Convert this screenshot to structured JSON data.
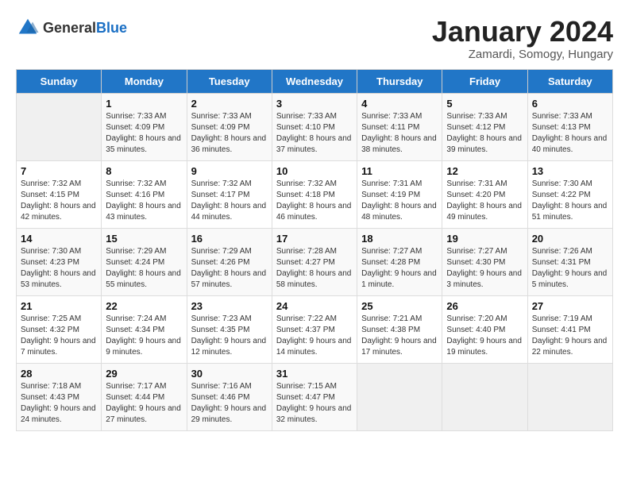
{
  "logo": {
    "general": "General",
    "blue": "Blue"
  },
  "header": {
    "month": "January 2024",
    "location": "Zamardi, Somogy, Hungary"
  },
  "days_of_week": [
    "Sunday",
    "Monday",
    "Tuesday",
    "Wednesday",
    "Thursday",
    "Friday",
    "Saturday"
  ],
  "weeks": [
    [
      {
        "day": "",
        "sunrise": "",
        "sunset": "",
        "daylight": "",
        "empty": true
      },
      {
        "day": "1",
        "sunrise": "Sunrise: 7:33 AM",
        "sunset": "Sunset: 4:09 PM",
        "daylight": "Daylight: 8 hours and 35 minutes."
      },
      {
        "day": "2",
        "sunrise": "Sunrise: 7:33 AM",
        "sunset": "Sunset: 4:09 PM",
        "daylight": "Daylight: 8 hours and 36 minutes."
      },
      {
        "day": "3",
        "sunrise": "Sunrise: 7:33 AM",
        "sunset": "Sunset: 4:10 PM",
        "daylight": "Daylight: 8 hours and 37 minutes."
      },
      {
        "day": "4",
        "sunrise": "Sunrise: 7:33 AM",
        "sunset": "Sunset: 4:11 PM",
        "daylight": "Daylight: 8 hours and 38 minutes."
      },
      {
        "day": "5",
        "sunrise": "Sunrise: 7:33 AM",
        "sunset": "Sunset: 4:12 PM",
        "daylight": "Daylight: 8 hours and 39 minutes."
      },
      {
        "day": "6",
        "sunrise": "Sunrise: 7:33 AM",
        "sunset": "Sunset: 4:13 PM",
        "daylight": "Daylight: 8 hours and 40 minutes."
      }
    ],
    [
      {
        "day": "7",
        "sunrise": "Sunrise: 7:32 AM",
        "sunset": "Sunset: 4:15 PM",
        "daylight": "Daylight: 8 hours and 42 minutes."
      },
      {
        "day": "8",
        "sunrise": "Sunrise: 7:32 AM",
        "sunset": "Sunset: 4:16 PM",
        "daylight": "Daylight: 8 hours and 43 minutes."
      },
      {
        "day": "9",
        "sunrise": "Sunrise: 7:32 AM",
        "sunset": "Sunset: 4:17 PM",
        "daylight": "Daylight: 8 hours and 44 minutes."
      },
      {
        "day": "10",
        "sunrise": "Sunrise: 7:32 AM",
        "sunset": "Sunset: 4:18 PM",
        "daylight": "Daylight: 8 hours and 46 minutes."
      },
      {
        "day": "11",
        "sunrise": "Sunrise: 7:31 AM",
        "sunset": "Sunset: 4:19 PM",
        "daylight": "Daylight: 8 hours and 48 minutes."
      },
      {
        "day": "12",
        "sunrise": "Sunrise: 7:31 AM",
        "sunset": "Sunset: 4:20 PM",
        "daylight": "Daylight: 8 hours and 49 minutes."
      },
      {
        "day": "13",
        "sunrise": "Sunrise: 7:30 AM",
        "sunset": "Sunset: 4:22 PM",
        "daylight": "Daylight: 8 hours and 51 minutes."
      }
    ],
    [
      {
        "day": "14",
        "sunrise": "Sunrise: 7:30 AM",
        "sunset": "Sunset: 4:23 PM",
        "daylight": "Daylight: 8 hours and 53 minutes."
      },
      {
        "day": "15",
        "sunrise": "Sunrise: 7:29 AM",
        "sunset": "Sunset: 4:24 PM",
        "daylight": "Daylight: 8 hours and 55 minutes."
      },
      {
        "day": "16",
        "sunrise": "Sunrise: 7:29 AM",
        "sunset": "Sunset: 4:26 PM",
        "daylight": "Daylight: 8 hours and 57 minutes."
      },
      {
        "day": "17",
        "sunrise": "Sunrise: 7:28 AM",
        "sunset": "Sunset: 4:27 PM",
        "daylight": "Daylight: 8 hours and 58 minutes."
      },
      {
        "day": "18",
        "sunrise": "Sunrise: 7:27 AM",
        "sunset": "Sunset: 4:28 PM",
        "daylight": "Daylight: 9 hours and 1 minute."
      },
      {
        "day": "19",
        "sunrise": "Sunrise: 7:27 AM",
        "sunset": "Sunset: 4:30 PM",
        "daylight": "Daylight: 9 hours and 3 minutes."
      },
      {
        "day": "20",
        "sunrise": "Sunrise: 7:26 AM",
        "sunset": "Sunset: 4:31 PM",
        "daylight": "Daylight: 9 hours and 5 minutes."
      }
    ],
    [
      {
        "day": "21",
        "sunrise": "Sunrise: 7:25 AM",
        "sunset": "Sunset: 4:32 PM",
        "daylight": "Daylight: 9 hours and 7 minutes."
      },
      {
        "day": "22",
        "sunrise": "Sunrise: 7:24 AM",
        "sunset": "Sunset: 4:34 PM",
        "daylight": "Daylight: 9 hours and 9 minutes."
      },
      {
        "day": "23",
        "sunrise": "Sunrise: 7:23 AM",
        "sunset": "Sunset: 4:35 PM",
        "daylight": "Daylight: 9 hours and 12 minutes."
      },
      {
        "day": "24",
        "sunrise": "Sunrise: 7:22 AM",
        "sunset": "Sunset: 4:37 PM",
        "daylight": "Daylight: 9 hours and 14 minutes."
      },
      {
        "day": "25",
        "sunrise": "Sunrise: 7:21 AM",
        "sunset": "Sunset: 4:38 PM",
        "daylight": "Daylight: 9 hours and 17 minutes."
      },
      {
        "day": "26",
        "sunrise": "Sunrise: 7:20 AM",
        "sunset": "Sunset: 4:40 PM",
        "daylight": "Daylight: 9 hours and 19 minutes."
      },
      {
        "day": "27",
        "sunrise": "Sunrise: 7:19 AM",
        "sunset": "Sunset: 4:41 PM",
        "daylight": "Daylight: 9 hours and 22 minutes."
      }
    ],
    [
      {
        "day": "28",
        "sunrise": "Sunrise: 7:18 AM",
        "sunset": "Sunset: 4:43 PM",
        "daylight": "Daylight: 9 hours and 24 minutes."
      },
      {
        "day": "29",
        "sunrise": "Sunrise: 7:17 AM",
        "sunset": "Sunset: 4:44 PM",
        "daylight": "Daylight: 9 hours and 27 minutes."
      },
      {
        "day": "30",
        "sunrise": "Sunrise: 7:16 AM",
        "sunset": "Sunset: 4:46 PM",
        "daylight": "Daylight: 9 hours and 29 minutes."
      },
      {
        "day": "31",
        "sunrise": "Sunrise: 7:15 AM",
        "sunset": "Sunset: 4:47 PM",
        "daylight": "Daylight: 9 hours and 32 minutes."
      },
      {
        "day": "",
        "sunrise": "",
        "sunset": "",
        "daylight": "",
        "empty": true
      },
      {
        "day": "",
        "sunrise": "",
        "sunset": "",
        "daylight": "",
        "empty": true
      },
      {
        "day": "",
        "sunrise": "",
        "sunset": "",
        "daylight": "",
        "empty": true
      }
    ]
  ]
}
